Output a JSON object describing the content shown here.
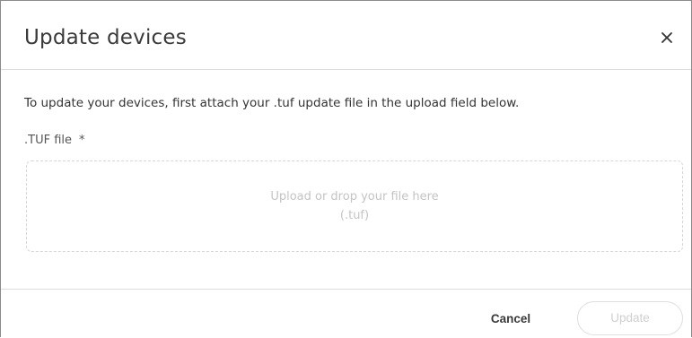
{
  "dialog": {
    "title": "Update devices",
    "close_icon": "close-icon",
    "intro_text": "To update your devices, first attach your .tuf update file in the upload field below.",
    "field": {
      "label": ".TUF file",
      "required_marker": "*"
    },
    "dropzone": {
      "line1": "Upload or drop your file here",
      "line2": "(.tuf)"
    },
    "footer": {
      "cancel_label": "Cancel",
      "update_label": "Update",
      "update_disabled": true
    }
  },
  "colors": {
    "border": "#8a8a8a",
    "divider": "#dcdcdc",
    "dropzone_text": "#c4c4c4",
    "disabled_button_text": "#cfcfcf"
  }
}
